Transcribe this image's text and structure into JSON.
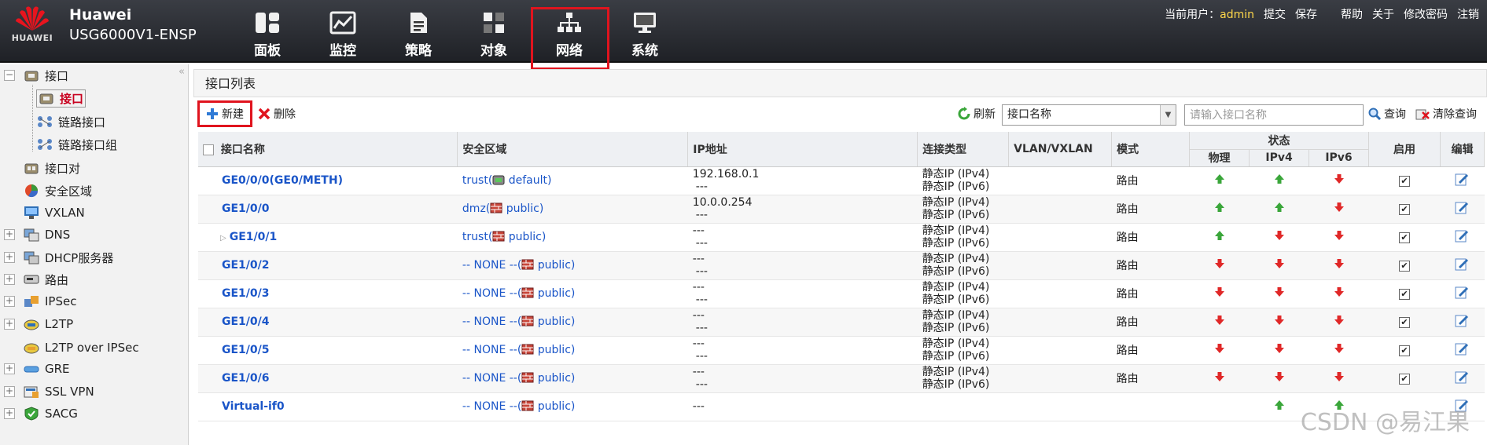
{
  "header": {
    "logo_text": "HUAWEI",
    "brand_line1": "Huawei",
    "brand_line2": "USG6000V1-ENSP",
    "nav": [
      {
        "label": "面板",
        "icon": "dashboard-icon"
      },
      {
        "label": "监控",
        "icon": "monitor-chart-icon"
      },
      {
        "label": "策略",
        "icon": "policy-document-icon"
      },
      {
        "label": "对象",
        "icon": "object-icon"
      },
      {
        "label": "网络",
        "icon": "network-topology-icon",
        "active": true
      },
      {
        "label": "系统",
        "icon": "system-monitor-icon"
      }
    ],
    "current_user_label": "当前用户：",
    "current_user": "admin",
    "links": [
      "提交",
      "保存",
      "帮助",
      "关于",
      "修改密码",
      "注销"
    ]
  },
  "sidebar": {
    "collapse_icon": "«",
    "items": [
      {
        "label": "接口",
        "icon": "interface-icon",
        "expander": "−",
        "level": 0
      },
      {
        "label": "接口",
        "icon": "interface-icon",
        "level": 1,
        "selected": true
      },
      {
        "label": "链路接口",
        "icon": "link-icon",
        "level": 1
      },
      {
        "label": "链路接口组",
        "icon": "link-icon",
        "level": 1
      },
      {
        "label": "接口对",
        "icon": "interface-pair-icon",
        "level": 0
      },
      {
        "label": "安全区域",
        "icon": "security-zone-icon",
        "level": 0
      },
      {
        "label": "VXLAN",
        "icon": "vxlan-icon",
        "level": 0
      },
      {
        "label": "DNS",
        "icon": "dns-icon",
        "expander": "+",
        "level": 0
      },
      {
        "label": "DHCP服务器",
        "icon": "dhcp-icon",
        "expander": "+",
        "level": 0
      },
      {
        "label": "路由",
        "icon": "route-icon",
        "expander": "+",
        "level": 0
      },
      {
        "label": "IPSec",
        "icon": "ipsec-icon",
        "expander": "+",
        "level": 0
      },
      {
        "label": "L2TP",
        "icon": "l2tp-icon",
        "expander": "+",
        "level": 0
      },
      {
        "label": "L2TP over IPSec",
        "icon": "l2tp-ipsec-icon",
        "level": 0
      },
      {
        "label": "GRE",
        "icon": "gre-icon",
        "expander": "+",
        "level": 0
      },
      {
        "label": "SSL VPN",
        "icon": "ssl-vpn-icon",
        "expander": "+",
        "level": 0
      },
      {
        "label": "SACG",
        "icon": "sacg-icon",
        "expander": "+",
        "level": 0
      }
    ]
  },
  "main": {
    "title": "接口列表",
    "toolbar": {
      "new_label": "新建",
      "delete_label": "删除",
      "refresh_label": "刷新",
      "select_value": "接口名称",
      "search_placeholder": "请输入接口名称",
      "query_label": "查询",
      "clear_label": "清除查询"
    },
    "table": {
      "headers": {
        "name": "接口名称",
        "zone": "安全区域",
        "ip": "IP地址",
        "conn": "连接类型",
        "vlan": "VLAN/VXLAN",
        "mode": "模式",
        "status": "状态",
        "physical": "物理",
        "ipv4": "IPv4",
        "ipv6": "IPv6",
        "enable": "启用",
        "edit": "编辑"
      },
      "rows": [
        {
          "name": "GE0/0/0(GE0/METH)",
          "zone_prefix": "trust(",
          "zone_vsys": "default)",
          "zone_icon": "vsys-default-icon",
          "ip1": "192.168.0.1",
          "ip2": "---",
          "conn1": "静态IP (IPv4)",
          "conn2": "静态IP (IPv6)",
          "mode": "路由",
          "phys": "up",
          "v4": "up",
          "v6": "down",
          "enabled": true
        },
        {
          "name": "GE1/0/0",
          "zone_prefix": "dmz(",
          "zone_vsys": "public)",
          "zone_icon": "firewall-icon",
          "ip1": "10.0.0.254",
          "ip2": "---",
          "conn1": "静态IP (IPv4)",
          "conn2": "静态IP (IPv6)",
          "mode": "路由",
          "phys": "up",
          "v4": "up",
          "v6": "down",
          "enabled": true
        },
        {
          "name": "GE1/0/1",
          "expandable": true,
          "zone_prefix": "trust(",
          "zone_vsys": "public)",
          "zone_icon": "firewall-icon",
          "ip1": "---",
          "ip2": "---",
          "conn1": "静态IP (IPv4)",
          "conn2": "静态IP (IPv6)",
          "mode": "路由",
          "phys": "up",
          "v4": "down",
          "v6": "down",
          "enabled": true
        },
        {
          "name": "GE1/0/2",
          "zone_prefix": "-- NONE --(",
          "zone_vsys": "public)",
          "zone_icon": "firewall-icon",
          "ip1": "---",
          "ip2": "---",
          "conn1": "静态IP (IPv4)",
          "conn2": "静态IP (IPv6)",
          "mode": "路由",
          "phys": "down",
          "v4": "down",
          "v6": "down",
          "enabled": true
        },
        {
          "name": "GE1/0/3",
          "zone_prefix": "-- NONE --(",
          "zone_vsys": "public)",
          "zone_icon": "firewall-icon",
          "ip1": "---",
          "ip2": "---",
          "conn1": "静态IP (IPv4)",
          "conn2": "静态IP (IPv6)",
          "mode": "路由",
          "phys": "down",
          "v4": "down",
          "v6": "down",
          "enabled": true
        },
        {
          "name": "GE1/0/4",
          "zone_prefix": "-- NONE --(",
          "zone_vsys": "public)",
          "zone_icon": "firewall-icon",
          "ip1": "---",
          "ip2": "---",
          "conn1": "静态IP (IPv4)",
          "conn2": "静态IP (IPv6)",
          "mode": "路由",
          "phys": "down",
          "v4": "down",
          "v6": "down",
          "enabled": true
        },
        {
          "name": "GE1/0/5",
          "zone_prefix": "-- NONE --(",
          "zone_vsys": "public)",
          "zone_icon": "firewall-icon",
          "ip1": "---",
          "ip2": "---",
          "conn1": "静态IP (IPv4)",
          "conn2": "静态IP (IPv6)",
          "mode": "路由",
          "phys": "down",
          "v4": "down",
          "v6": "down",
          "enabled": true
        },
        {
          "name": "GE1/0/6",
          "zone_prefix": "-- NONE --(",
          "zone_vsys": "public)",
          "zone_icon": "firewall-icon",
          "ip1": "---",
          "ip2": "---",
          "conn1": "静态IP (IPv4)",
          "conn2": "静态IP (IPv6)",
          "mode": "路由",
          "phys": "down",
          "v4": "down",
          "v6": "down",
          "enabled": true
        },
        {
          "name": "Virtual-if0",
          "zone_prefix": "-- NONE --(",
          "zone_vsys": "public)",
          "zone_icon": "firewall-icon",
          "ip1": "---",
          "ip2": "",
          "conn1": "",
          "conn2": "",
          "mode": "",
          "phys": "",
          "v4": "up",
          "v6": "up",
          "enabled": false
        }
      ]
    }
  },
  "colors": {
    "up": "#3aa63a",
    "down": "#e02828",
    "link": "#1a55c8",
    "highlight": "#e0141e"
  },
  "watermark": "CSDN @易江果"
}
